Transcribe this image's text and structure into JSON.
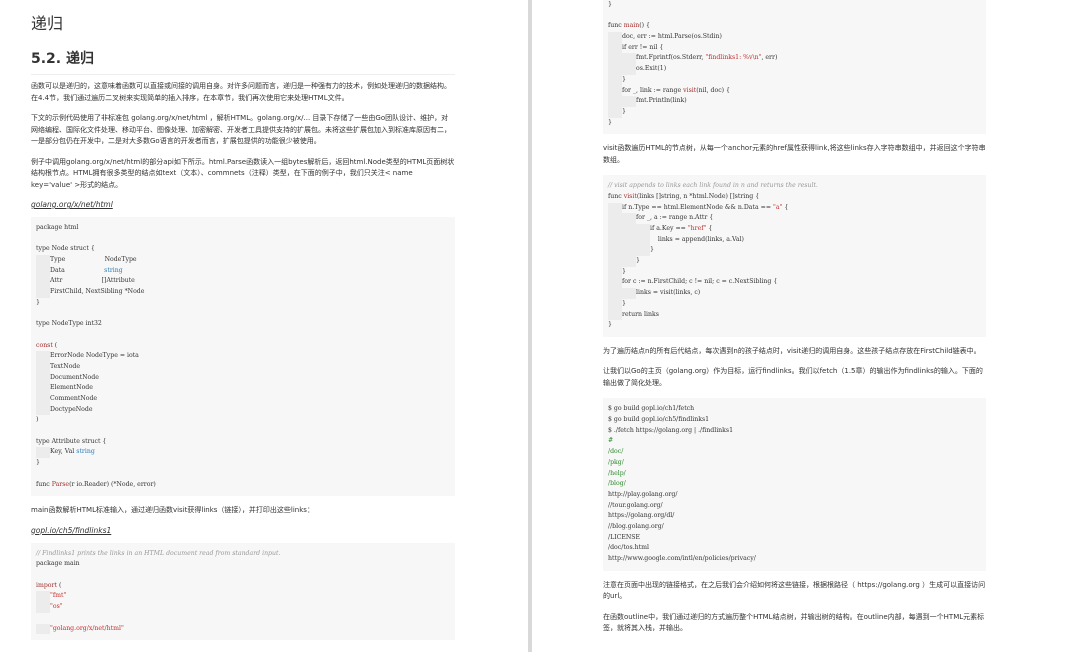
{
  "left": {
    "chapter_title": "递归",
    "section_title": "5.2. 递归",
    "p1": "函数可以是递归的，这意味着函数可以直接或间接的调用自身。对许多问题而言，递归是一种强有力的技术，例如处理递归的数据结构。在4.4节，我们通过遍历二叉树来实现简单的插入排序，在本章节，我们再次使用它来处理HTML文件。",
    "p2": "下文的示例代码使用了非标准包 golang.org/x/net/html ，解析HTML。golang.org/x/... 目录下存储了一些由Go团队设计、维护，对网络编程、国际化文件处理、移动平台、图像处理、加密解密、开发者工具提供支持的扩展包。未将这些扩展包加入到标准库原因有二，一是部分包仍在开发中，二是对大多数Go语言的开发者而言，扩展包提供的功能很少被使用。",
    "p3": "例子中调用golang.org/x/net/html的部分api如下所示。html.Parse函数读入一组bytes解析后，返回html.Node类型的HTML页面树状结构根节点。HTML拥有很多类型的结点如text（文本）、commnets（注释）类型，在下面的例子中，我们只关注< name key='value' >形式的结点。",
    "link1": "golang.org/x/net/html",
    "code1": [
      {
        "cls": "",
        "segs": [
          {
            "c": "pl",
            "t": "package html"
          }
        ]
      },
      {
        "cls": "",
        "segs": []
      },
      {
        "cls": "",
        "segs": [
          {
            "c": "pl",
            "t": "type Node struct {"
          }
        ]
      },
      {
        "cls": "i1",
        "segs": [
          {
            "c": "pl",
            "t": "Type                    NodeType"
          }
        ]
      },
      {
        "cls": "i1",
        "segs": [
          {
            "c": "pl",
            "t": "Data                    "
          },
          {
            "c": "ty",
            "t": "string"
          }
        ]
      },
      {
        "cls": "i1",
        "segs": [
          {
            "c": "pl",
            "t": "Attr                    []Attribute"
          }
        ]
      },
      {
        "cls": "i1",
        "segs": [
          {
            "c": "pl",
            "t": "FirstChild, NextSibling *Node"
          }
        ]
      },
      {
        "cls": "",
        "segs": [
          {
            "c": "pl",
            "t": "}"
          }
        ]
      },
      {
        "cls": "",
        "segs": []
      },
      {
        "cls": "",
        "segs": [
          {
            "c": "pl",
            "t": "type NodeType int32"
          }
        ]
      },
      {
        "cls": "",
        "segs": []
      },
      {
        "cls": "",
        "segs": [
          {
            "c": "kw",
            "t": "const"
          },
          {
            "c": "pl",
            "t": " ("
          }
        ]
      },
      {
        "cls": "i1",
        "segs": [
          {
            "c": "pl",
            "t": "ErrorNode NodeType = iota"
          }
        ]
      },
      {
        "cls": "i1",
        "segs": [
          {
            "c": "pl",
            "t": "TextNode"
          }
        ]
      },
      {
        "cls": "i1",
        "segs": [
          {
            "c": "pl",
            "t": "DocumentNode"
          }
        ]
      },
      {
        "cls": "i1",
        "segs": [
          {
            "c": "pl",
            "t": "ElementNode"
          }
        ]
      },
      {
        "cls": "i1",
        "segs": [
          {
            "c": "pl",
            "t": "CommentNode"
          }
        ]
      },
      {
        "cls": "i1",
        "segs": [
          {
            "c": "pl",
            "t": "DoctypeNode"
          }
        ]
      },
      {
        "cls": "",
        "segs": [
          {
            "c": "pl",
            "t": ")"
          }
        ]
      },
      {
        "cls": "",
        "segs": []
      },
      {
        "cls": "",
        "segs": [
          {
            "c": "pl",
            "t": "type Attribute struct {"
          }
        ]
      },
      {
        "cls": "i1",
        "segs": [
          {
            "c": "pl",
            "t": "Key, Val "
          },
          {
            "c": "ty",
            "t": "string"
          }
        ]
      },
      {
        "cls": "",
        "segs": [
          {
            "c": "pl",
            "t": "}"
          }
        ]
      },
      {
        "cls": "",
        "segs": []
      },
      {
        "cls": "",
        "segs": [
          {
            "c": "pl",
            "t": "func "
          },
          {
            "c": "fn",
            "t": "Parse"
          },
          {
            "c": "pl",
            "t": "(r io.Reader) (*Node, error)"
          }
        ]
      }
    ],
    "p4": "main函数解析HTML标准输入，通过递归函数visit获得links（链接），并打印出这些links：",
    "link2": "gopl.io/ch5/findlinks1",
    "code2": [
      {
        "cls": "",
        "segs": [
          {
            "c": "cm",
            "t": "// Findlinks1 prints the links in an HTML document read from standard input."
          }
        ]
      },
      {
        "cls": "",
        "segs": [
          {
            "c": "pl",
            "t": "package main"
          }
        ]
      },
      {
        "cls": "",
        "segs": []
      },
      {
        "cls": "",
        "segs": [
          {
            "c": "kw",
            "t": "import"
          },
          {
            "c": "pl",
            "t": " ("
          }
        ]
      },
      {
        "cls": "i1",
        "segs": [
          {
            "c": "str",
            "t": "\"fmt\""
          }
        ]
      },
      {
        "cls": "i1",
        "segs": [
          {
            "c": "str",
            "t": "\"os\""
          }
        ]
      },
      {
        "cls": "",
        "segs": []
      },
      {
        "cls": "i1",
        "segs": [
          {
            "c": "str",
            "t": "\"golang.org/x/net/html\""
          }
        ]
      }
    ]
  },
  "right": {
    "code3": [
      {
        "cls": "",
        "segs": [
          {
            "c": "pl",
            "t": "}"
          }
        ]
      },
      {
        "cls": "",
        "segs": []
      },
      {
        "cls": "",
        "segs": [
          {
            "c": "pl",
            "t": "func "
          },
          {
            "c": "fn",
            "t": "main"
          },
          {
            "c": "pl",
            "t": "() {"
          }
        ]
      },
      {
        "cls": "i1",
        "segs": [
          {
            "c": "pl",
            "t": "doc, err := html.Parse(os.Stdin)"
          }
        ]
      },
      {
        "cls": "i1",
        "segs": [
          {
            "c": "pl",
            "t": "if err != nil {"
          }
        ]
      },
      {
        "cls": "i2",
        "segs": [
          {
            "c": "pl",
            "t": "fmt.Fprintf(os.Stderr, "
          },
          {
            "c": "str",
            "t": "\"findlinks1: %v\\n\""
          },
          {
            "c": "pl",
            "t": ", err)"
          }
        ]
      },
      {
        "cls": "i2",
        "segs": [
          {
            "c": "pl",
            "t": "os.Exit(1)"
          }
        ]
      },
      {
        "cls": "i1",
        "segs": [
          {
            "c": "pl",
            "t": "}"
          }
        ]
      },
      {
        "cls": "i1",
        "segs": [
          {
            "c": "pl",
            "t": "for _, link := range "
          },
          {
            "c": "fn",
            "t": "visit"
          },
          {
            "c": "pl",
            "t": "(nil, doc) {"
          }
        ]
      },
      {
        "cls": "i2",
        "segs": [
          {
            "c": "pl",
            "t": "fmt.Println(link)"
          }
        ]
      },
      {
        "cls": "i1",
        "segs": [
          {
            "c": "pl",
            "t": "}"
          }
        ]
      },
      {
        "cls": "",
        "segs": [
          {
            "c": "pl",
            "t": "}"
          }
        ]
      }
    ],
    "p5": "visit函数遍历HTML的节点树，从每一个anchor元素的href属性获得link,将这些links存入字符串数组中，并返回这个字符串数组。",
    "code4": [
      {
        "cls": "",
        "segs": [
          {
            "c": "cm",
            "t": "// visit appends to links each link found in n and returns the result."
          }
        ]
      },
      {
        "cls": "",
        "segs": [
          {
            "c": "pl",
            "t": "func "
          },
          {
            "c": "fn",
            "t": "visit"
          },
          {
            "c": "pl",
            "t": "(links []string, n *html.Node) []string {"
          }
        ]
      },
      {
        "cls": "i1",
        "segs": [
          {
            "c": "pl",
            "t": "if n.Type == html.ElementNode && n.Data == "
          },
          {
            "c": "str",
            "t": "\"a\""
          },
          {
            "c": "pl",
            "t": " {"
          }
        ]
      },
      {
        "cls": "i2",
        "segs": [
          {
            "c": "pl",
            "t": "for _, a := range n.Attr {"
          }
        ]
      },
      {
        "cls": "i3",
        "segs": [
          {
            "c": "pl",
            "t": "if a.Key == "
          },
          {
            "c": "str",
            "t": "\"href\""
          },
          {
            "c": "pl",
            "t": " {"
          }
        ]
      },
      {
        "cls": "i3",
        "segs": [
          {
            "c": "pl",
            "t": "    links = append(links, a.Val)"
          }
        ]
      },
      {
        "cls": "i3",
        "segs": [
          {
            "c": "pl",
            "t": "}"
          }
        ]
      },
      {
        "cls": "i2",
        "segs": [
          {
            "c": "pl",
            "t": "}"
          }
        ]
      },
      {
        "cls": "i1",
        "segs": [
          {
            "c": "pl",
            "t": "}"
          }
        ]
      },
      {
        "cls": "i1",
        "segs": [
          {
            "c": "pl",
            "t": "for c := n.FirstChild; c != nil; c = c.NextSibling {"
          }
        ]
      },
      {
        "cls": "i2",
        "segs": [
          {
            "c": "pl",
            "t": "links = visit(links, c)"
          }
        ]
      },
      {
        "cls": "i1",
        "segs": [
          {
            "c": "pl",
            "t": "}"
          }
        ]
      },
      {
        "cls": "i1",
        "segs": [
          {
            "c": "pl",
            "t": "return links"
          }
        ]
      },
      {
        "cls": "",
        "segs": [
          {
            "c": "pl",
            "t": "}"
          }
        ]
      }
    ],
    "p6": "为了遍历结点n的所有后代结点，每次遇到n的孩子结点时，visit递归的调用自身。这些孩子结点存放在FirstChild链表中。",
    "p7": "让我们以Go的主页（golang.org）作为目标，运行findlinks。我们以fetch（1.5章）的输出作为findlinks的输入。下面的输出做了简化处理。",
    "code5": [
      {
        "cls": "",
        "segs": [
          {
            "c": "pl",
            "t": "$ go build gopl.io/ch1/fetch"
          }
        ]
      },
      {
        "cls": "",
        "segs": [
          {
            "c": "pl",
            "t": "$ go build gopl.io/ch5/findlinks1"
          }
        ]
      },
      {
        "cls": "",
        "segs": [
          {
            "c": "pl",
            "t": "$ ./fetch https://golang.org | ./findlinks1"
          }
        ]
      },
      {
        "cls": "",
        "segs": [
          {
            "c": "gr",
            "t": "#"
          }
        ]
      },
      {
        "cls": "",
        "segs": [
          {
            "c": "gr",
            "t": "/doc/"
          }
        ]
      },
      {
        "cls": "",
        "segs": [
          {
            "c": "gr",
            "t": "/pkg/"
          }
        ]
      },
      {
        "cls": "",
        "segs": [
          {
            "c": "gr",
            "t": "/help/"
          }
        ]
      },
      {
        "cls": "",
        "segs": [
          {
            "c": "gr",
            "t": "/blog/"
          }
        ]
      },
      {
        "cls": "",
        "segs": [
          {
            "c": "pl",
            "t": "http://play.golang.org/"
          }
        ]
      },
      {
        "cls": "",
        "segs": [
          {
            "c": "pl",
            "t": "//tour.golang.org/"
          }
        ]
      },
      {
        "cls": "",
        "segs": [
          {
            "c": "pl",
            "t": "https://golang.org/dl/"
          }
        ]
      },
      {
        "cls": "",
        "segs": [
          {
            "c": "pl",
            "t": "//blog.golang.org/"
          }
        ]
      },
      {
        "cls": "",
        "segs": [
          {
            "c": "pl",
            "t": "/LICENSE"
          }
        ]
      },
      {
        "cls": "",
        "segs": [
          {
            "c": "pl",
            "t": "/doc/tos.html"
          }
        ]
      },
      {
        "cls": "",
        "segs": [
          {
            "c": "pl",
            "t": "http://www.google.com/intl/en/policies/privacy/"
          }
        ]
      }
    ],
    "p8": "注意在页面中出现的链接格式，在之后我们会介绍如何将这些链接，根据根路径（ https://golang.org ）生成可以直接访问的url。",
    "p9": "在函数outline中，我们通过递归的方式遍历整个HTML结点树，并输出树的结构。在outline内部，每遇到一个HTML元素标签，就将其入栈，并输出。"
  }
}
